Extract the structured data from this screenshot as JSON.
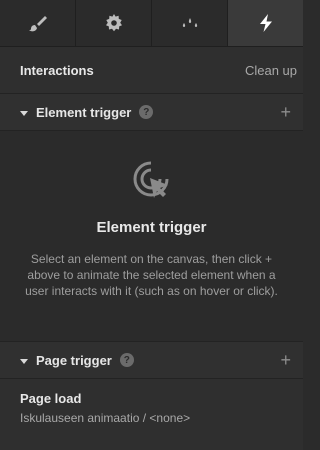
{
  "tabs": [
    {
      "icon": "brush-icon",
      "active": false
    },
    {
      "icon": "gear-icon",
      "active": false
    },
    {
      "icon": "drops-icon",
      "active": false
    },
    {
      "icon": "lightning-icon",
      "active": true
    }
  ],
  "panel": {
    "title": "Interactions",
    "clean_up": "Clean up"
  },
  "element_trigger": {
    "label": "Element trigger",
    "help": "?",
    "add": "+",
    "empty_icon": "click-target-icon",
    "empty_title": "Element trigger",
    "empty_description": "Select an element on the canvas, then click + above to animate the selected element when a user interacts with it (such as on hover or click)."
  },
  "page_trigger": {
    "label": "Page trigger",
    "help": "?",
    "add": "+",
    "item_name": "Page load",
    "item_detail": "Iskulauseen animaatio / <none>"
  },
  "colors": {
    "background": "#2b2b2b",
    "active_tab": "#3a3a3a",
    "text": "#e8e8e8",
    "muted_text": "#9e9e9e"
  }
}
